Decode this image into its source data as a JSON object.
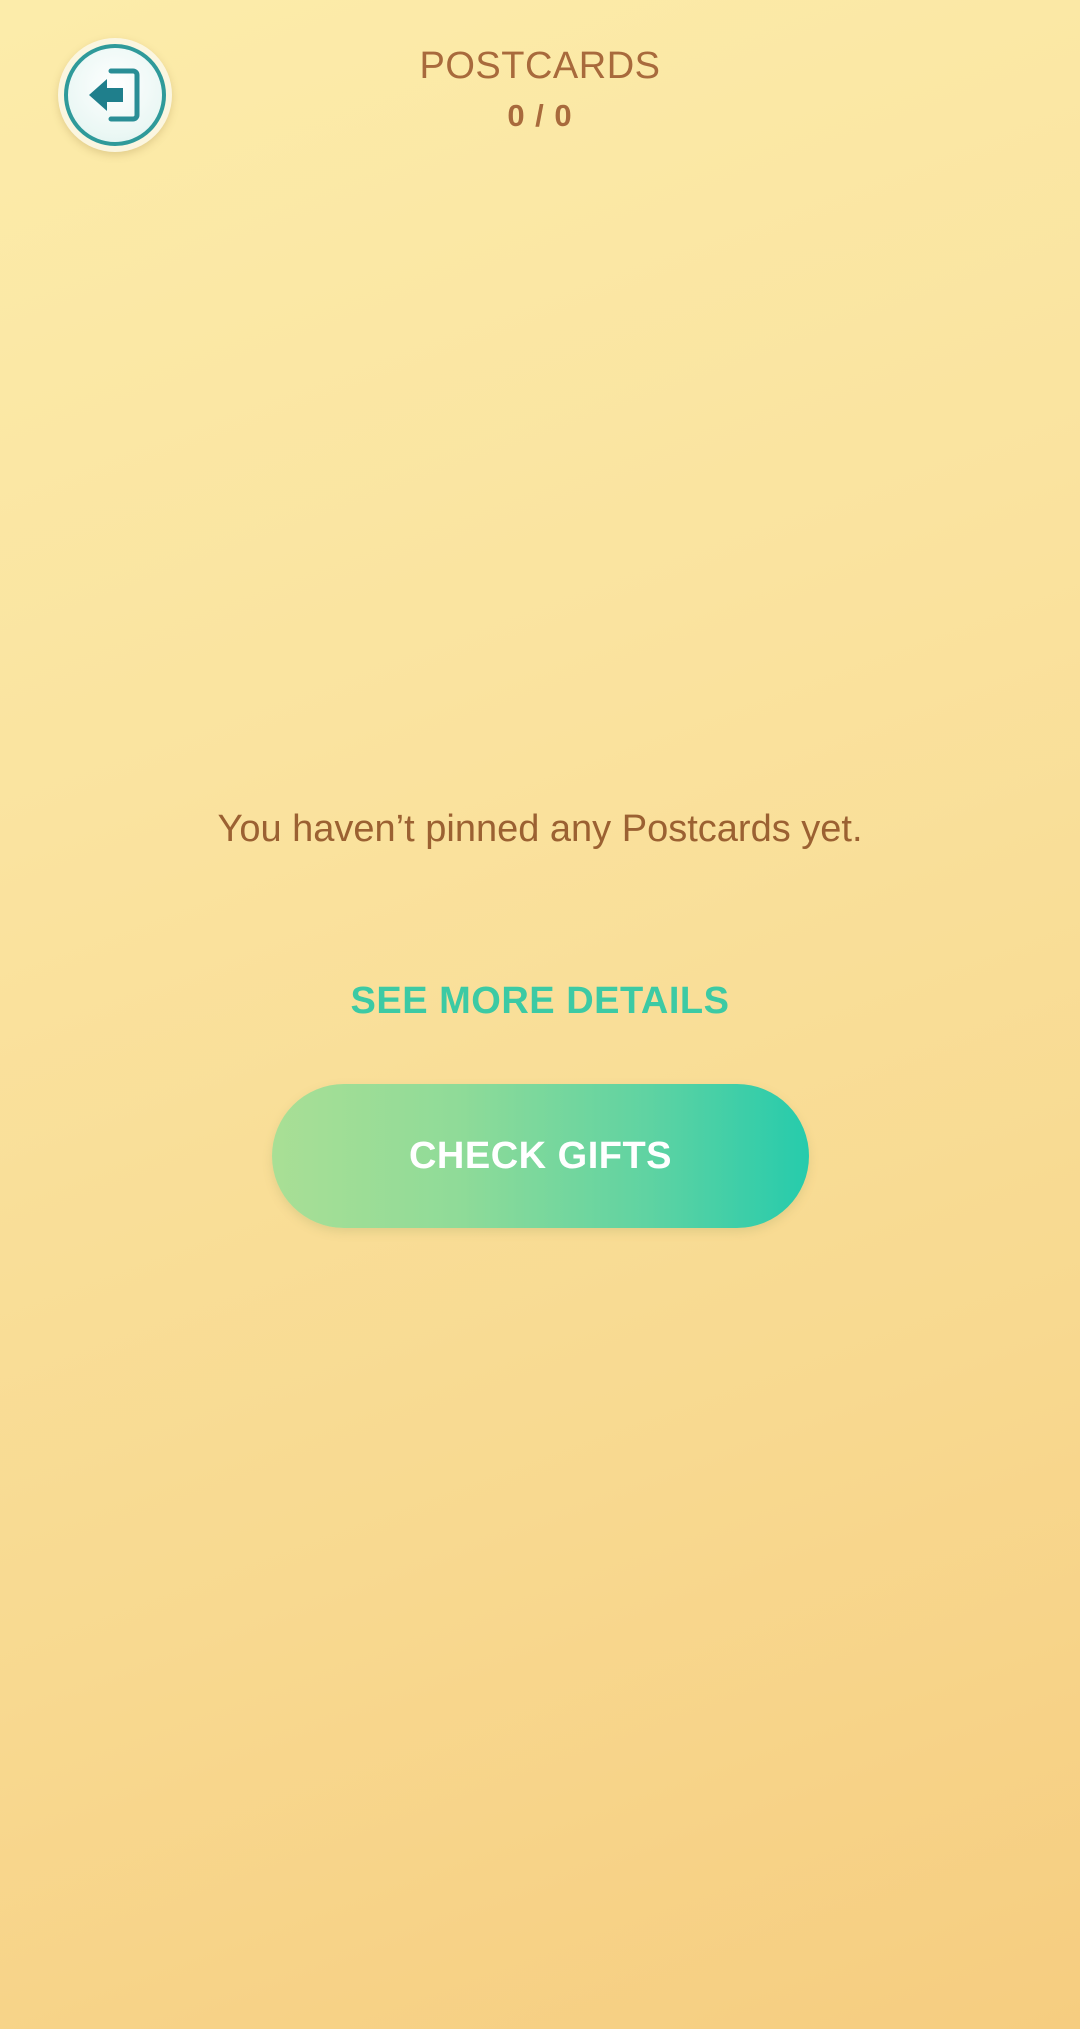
{
  "header": {
    "title": "POSTCARDS",
    "counter": "0 / 0"
  },
  "exit_button": {
    "icon": "exit-arrow-icon"
  },
  "main": {
    "empty_message": "You haven’t pinned any Postcards yet.",
    "details_link": "SEE MORE DETAILS",
    "check_gifts_label": "CHECK GIFTS"
  },
  "colors": {
    "background_top": "#fcecaa",
    "background_bottom": "#f6cd80",
    "text_brown": "#a86a3c",
    "accent_teal": "#3ccaa4",
    "button_gradient_start": "#a9df95",
    "button_gradient_end": "#26cbac"
  }
}
